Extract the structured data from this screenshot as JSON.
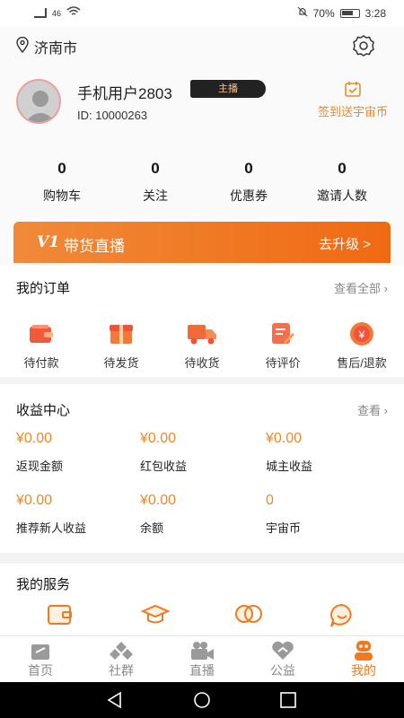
{
  "status": {
    "time": "3:28",
    "battery": "70%",
    "network": "46"
  },
  "location": {
    "city": "济南市"
  },
  "user": {
    "name": "手机用户2803",
    "role": "主播",
    "id": "ID:  10000263",
    "checkin": "签到送宇宙币"
  },
  "stats": [
    {
      "value": "0",
      "label": "购物车"
    },
    {
      "value": "0",
      "label": "关注"
    },
    {
      "value": "0",
      "label": "优惠券"
    },
    {
      "value": "0",
      "label": "邀请人数"
    }
  ],
  "banner": {
    "logo": "V1",
    "title": "带货直播",
    "action": "去升级 >"
  },
  "orders": {
    "title": "我的订单",
    "more": "查看全部",
    "items": [
      {
        "label": "待付款",
        "icon": "wallet-icon"
      },
      {
        "label": "待发货",
        "icon": "package-icon"
      },
      {
        "label": "待收货",
        "icon": "truck-icon"
      },
      {
        "label": "待评价",
        "icon": "review-icon"
      },
      {
        "label": "售后/退款",
        "icon": "refund-icon"
      }
    ]
  },
  "earnings": {
    "title": "收益中心",
    "more": "查看",
    "items": [
      {
        "value": "¥0.00",
        "label": "返现金额"
      },
      {
        "value": "¥0.00",
        "label": "红包收益"
      },
      {
        "value": "¥0.00",
        "label": "城主收益"
      },
      {
        "value": "¥0.00",
        "label": "推荐新人收益"
      },
      {
        "value": "¥0.00",
        "label": "余额"
      },
      {
        "value": "0",
        "label": "宇宙币"
      }
    ]
  },
  "services": {
    "title": "我的服务",
    "icons": [
      "wallet-service-icon",
      "graduation-cap-icon",
      "chat-bubbles-icon",
      "smile-chat-icon"
    ]
  },
  "tabs": [
    {
      "label": "首页",
      "icon": "home-icon"
    },
    {
      "label": "社群",
      "icon": "community-icon"
    },
    {
      "label": "直播",
      "icon": "video-camera-icon"
    },
    {
      "label": "公益",
      "icon": "charity-icon"
    },
    {
      "label": "我的",
      "icon": "profile-icon",
      "active": true
    }
  ],
  "colors": {
    "accent": "#f07a20",
    "earn": "#e88a2a",
    "role_bg": "#222222",
    "role_text": "#f5c78a"
  }
}
